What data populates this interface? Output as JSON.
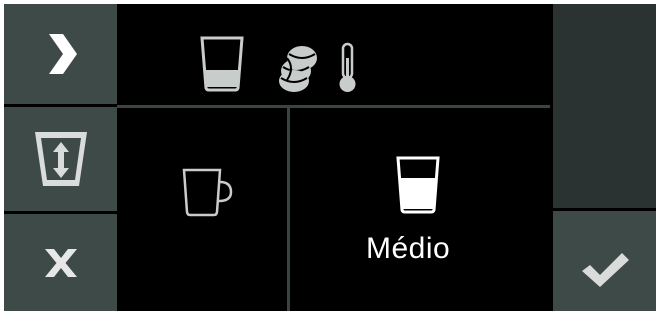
{
  "left_panel": {
    "next_icon": "chevron-right-icon",
    "cup_volume_icon": "cup-volume-icon",
    "cancel_icon": "x-icon"
  },
  "header_icons": [
    "glass-icon",
    "coffee-beans-icon",
    "thermometer-icon"
  ],
  "options": [
    {
      "icon": "mug-icon",
      "label": ""
    },
    {
      "icon": "glass-icon",
      "label": "Médio"
    }
  ],
  "right_panel": {
    "confirm_icon": "check-icon"
  },
  "colors": {
    "button_bg": "#3e4a47",
    "right_bg": "#2a3331",
    "divider": "#3a4442",
    "icon_gray": "#c8cccb",
    "screen_bg": "#000000"
  }
}
